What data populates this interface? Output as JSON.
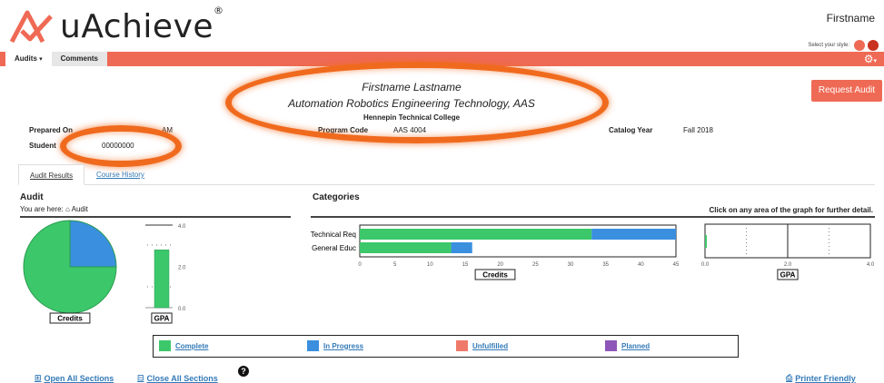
{
  "header": {
    "logo_text": "uAchieve",
    "logo_reg": "®",
    "user": "Firstname",
    "style_label": "Select your style:",
    "style_colors": [
      "#ef6a55",
      "#c9321f"
    ]
  },
  "nav": {
    "tabs": [
      {
        "label": "Audits",
        "caret": "▾"
      },
      {
        "label": "Comments"
      }
    ],
    "bar_color": "#ef6a55"
  },
  "student": {
    "name": "Firstname Lastname",
    "program": "Automation Robotics Engineering Technology, AAS",
    "college": "Hennepin Technical College",
    "request_button": "Request Audit"
  },
  "info": {
    "prepared_on_label": "Prepared On",
    "prepared_on_value": "AM",
    "student_label": "Student",
    "student_value": "00000000",
    "program_code_label": "Program Code",
    "program_code_value": "AAS 4004",
    "catalog_year_label": "Catalog Year",
    "catalog_year_value": "Fall 2018"
  },
  "tabs": [
    {
      "label": "Audit Results",
      "active": true
    },
    {
      "label": "Course History",
      "active": false
    }
  ],
  "audit": {
    "title": "Audit",
    "breadcrumb_prefix": "You are here:",
    "breadcrumb_icon": "home-icon",
    "breadcrumb_item": "Audit"
  },
  "categories": {
    "title": "Categories",
    "hint": "Click on any area of the graph for further detail."
  },
  "legend": [
    {
      "label": "Complete",
      "color": "#3cc86a"
    },
    {
      "label": "In Progress",
      "color": "#3a8fde"
    },
    {
      "label": "Unfulfilled",
      "color": "#ef7a6a"
    },
    {
      "label": "Planned",
      "color": "#8e56b8"
    }
  ],
  "footer": {
    "open_all": "Open All Sections",
    "close_all": "Close All Sections",
    "help": "?",
    "printer": "Printer Friendly"
  },
  "chart_data": [
    {
      "type": "pie",
      "xlabel": "Credits",
      "slices": [
        {
          "label": "Complete",
          "value": 75,
          "color": "#3cc86a"
        },
        {
          "label": "In Progress",
          "value": 25,
          "color": "#3a8fde"
        }
      ]
    },
    {
      "type": "bar",
      "xlabel": "GPA",
      "ylim": [
        0,
        4
      ],
      "yticks": [
        "0.0",
        "2.0",
        "4.0"
      ],
      "values": [
        2.8
      ],
      "color": "#3cc86a"
    },
    {
      "type": "bar",
      "orientation": "horizontal",
      "xlabel": "Credits",
      "categories": [
        "Technical Req",
        "General Educ"
      ],
      "xlim": [
        0,
        45
      ],
      "xticks": [
        "0",
        "5",
        "10",
        "15",
        "20",
        "25",
        "30",
        "35",
        "40",
        "45"
      ],
      "series": [
        {
          "name": "Complete",
          "values": [
            33,
            13
          ],
          "color": "#3cc86a"
        },
        {
          "name": "In Progress",
          "values": [
            12,
            3
          ],
          "color": "#3a8fde"
        }
      ]
    },
    {
      "type": "bar",
      "orientation": "horizontal",
      "xlabel": "GPA",
      "xlim": [
        0,
        4
      ],
      "xticks": [
        "0.0",
        "2.0",
        "4.0"
      ],
      "values": [
        0
      ]
    }
  ]
}
